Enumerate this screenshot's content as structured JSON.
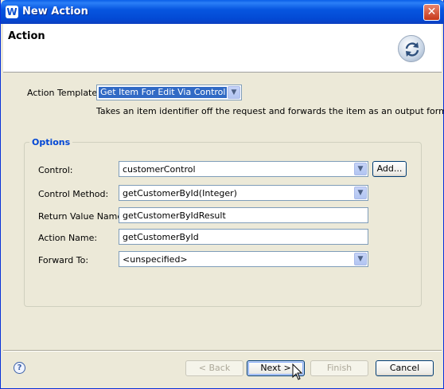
{
  "window": {
    "title": "New Action",
    "close_glyph": "✕",
    "logo_glyph": "W",
    "logo_icon": "app-logo-icon"
  },
  "header": {
    "title": "Action",
    "icon": "refresh-arrows-icon"
  },
  "template": {
    "label": "Action Template:",
    "value": "Get Item For Edit Via Control",
    "description": "Takes an item identifier off the request and forwards the item as an output form."
  },
  "options": {
    "legend": "Options",
    "control_label": "Control:",
    "control_value": "customerControl",
    "add_label": "Add...",
    "method_label": "Control Method:",
    "method_value": "getCustomerById(Integer)",
    "return_label": "Return Value Name:",
    "return_value": "getCustomerByIdResult",
    "name_label": "Action Name:",
    "name_value": "getCustomerById",
    "forward_label": "Forward To:",
    "forward_value": "<unspecified>"
  },
  "footer": {
    "help_glyph": "?",
    "back_label": "< Back",
    "next_label": "Next >",
    "finish_label": "Finish",
    "cancel_label": "Cancel"
  },
  "colors": {
    "titlebar": "#0756e0",
    "selection": "#316ac5",
    "legend": "#0046d5",
    "dialog_bg": "#ece9d8"
  }
}
